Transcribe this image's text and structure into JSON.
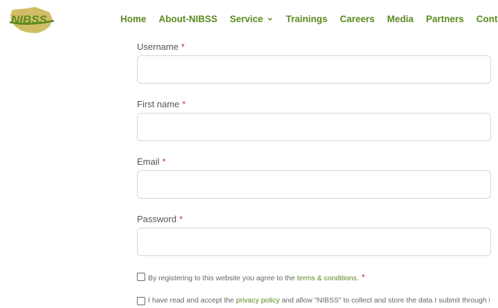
{
  "brand": {
    "logo_text": "NIBSS",
    "accent": "#5a8a1e",
    "logo_shape": "#c8b24a"
  },
  "nav": {
    "items": [
      {
        "label": "Home",
        "dropdown": false
      },
      {
        "label": "About-NIBSS",
        "dropdown": false
      },
      {
        "label": "Service",
        "dropdown": true
      },
      {
        "label": "Trainings",
        "dropdown": false
      },
      {
        "label": "Careers",
        "dropdown": false
      },
      {
        "label": "Media",
        "dropdown": false
      },
      {
        "label": "Partners",
        "dropdown": false
      },
      {
        "label": "Contact",
        "dropdown": true
      }
    ]
  },
  "form": {
    "required_mark": "*",
    "fields": [
      {
        "label": "Username",
        "value": ""
      },
      {
        "label": "First name",
        "value": ""
      },
      {
        "label": "Email",
        "value": ""
      },
      {
        "label": "Password",
        "value": ""
      }
    ],
    "terms": {
      "text_before": "By registering to this website you agree to the",
      "link": "terms & conditions.",
      "required_mark": "*"
    },
    "privacy": {
      "text_before": "I have read and accept the",
      "link": "privacy policy",
      "text_after": "and allow \"NIBSS\" to collect and store the data I submit through this"
    }
  }
}
